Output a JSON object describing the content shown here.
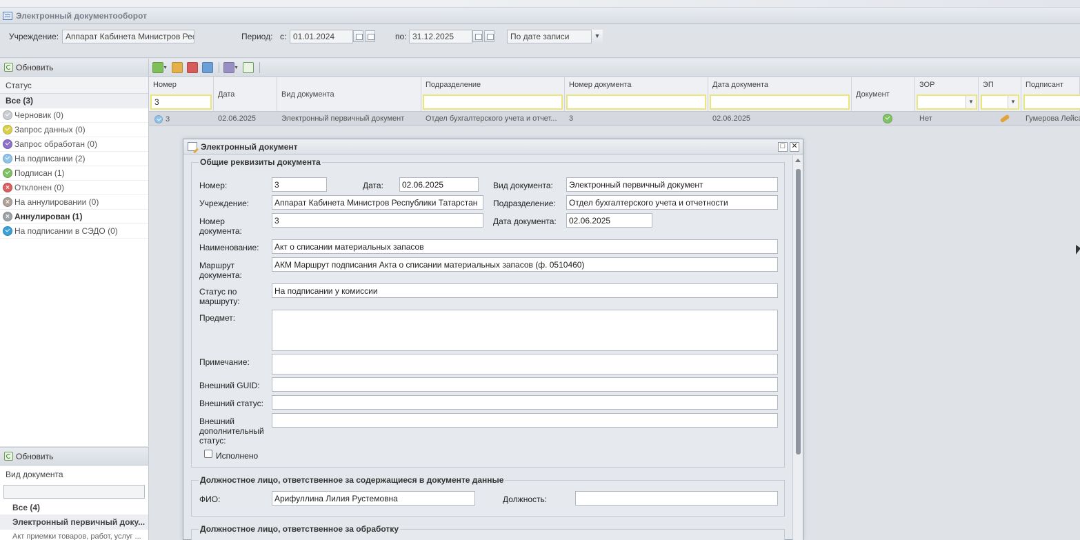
{
  "app": {
    "title": "Электронный документооборот"
  },
  "filters": {
    "institution_label": "Учреждение:",
    "institution_value": "Аппарат Кабинета Министров Рес",
    "period_label": "Период:",
    "from_label": "с:",
    "from_value": "01.01.2024",
    "to_label": "по:",
    "to_value": "31.12.2025",
    "date_mode": "По дате записи"
  },
  "status_panel": {
    "refresh_label": "Обновить",
    "header": "Статус",
    "items": [
      {
        "label": "Все (3)",
        "color": ""
      },
      {
        "label": "Черновик (0)",
        "color": "#c9cdd3"
      },
      {
        "label": "Запрос данных (0)",
        "color": "#d9d04a"
      },
      {
        "label": "Запрос обработан (0)",
        "color": "#8e6fc9"
      },
      {
        "label": "На подписании (2)",
        "color": "#8fc3ea"
      },
      {
        "label": "Подписан (1)",
        "color": "#7fc264"
      },
      {
        "label": "Отклонен (0)",
        "color": "#d96060"
      },
      {
        "label": "На аннулировании (0)",
        "color": "#b0a29b"
      },
      {
        "label": "Аннулирован (1)",
        "color": "#9ea3aa"
      },
      {
        "label": "На подписании в СЭДО (0)",
        "color": "#3aa0d8"
      }
    ]
  },
  "doctype_panel": {
    "refresh_label": "Обновить",
    "header": "Вид документа",
    "items": [
      {
        "label": "Все (4)"
      },
      {
        "label": "Электронный первичный доку..."
      },
      {
        "label": "Акт приемки товаров, работ, услуг ..."
      }
    ]
  },
  "grid": {
    "columns": [
      "Номер",
      "Дата",
      "Вид документа",
      "Подразделение",
      "Номер документа",
      "Дата документа",
      "Документ",
      "ЗОР",
      "ЭП",
      "Подписант"
    ],
    "filter_number": "3",
    "row": {
      "number": "3",
      "date": "02.06.2025",
      "doc_type": "Электронный первичный документ",
      "department": "Отдел бухгалтерского учета и отчет...",
      "doc_number": "3",
      "doc_date": "02.06.2025",
      "zor": "Нет",
      "signer": "Гумерова Лейсан"
    }
  },
  "dialog": {
    "title": "Электронный документ",
    "section_general": "Общие реквизиты документа",
    "labels": {
      "number": "Номер:",
      "date": "Дата:",
      "doc_type": "Вид документа:",
      "institution": "Учреждение:",
      "department": "Подразделение:",
      "doc_number": "Номер документа:",
      "doc_date": "Дата документа:",
      "name": "Наименование:",
      "route": "Маршрут документа:",
      "route_status": "Статус по маршруту:",
      "subject": "Предмет:",
      "note": "Примечание:",
      "ext_guid": "Внешний GUID:",
      "ext_status": "Внешний статус:",
      "ext_add_status": "Внешний дополнительный статус:",
      "done": "Исполнено"
    },
    "values": {
      "number": "3",
      "date": "02.06.2025",
      "doc_type": "Электронный первичный документ",
      "institution": "Аппарат Кабинета Министров Республики Татарстан",
      "department": "Отдел бухгалтерского учета и отчетности",
      "doc_number": "3",
      "doc_date": "02.06.2025",
      "name": "Акт о списании материальных запасов",
      "route": "АКМ Маршрут подписания Акта о списании материальных запасов (ф. 0510460)",
      "route_status": "На подписании у комиссии",
      "subject": "",
      "note": "",
      "ext_guid": "",
      "ext_status": "",
      "ext_add_status": ""
    },
    "section_responsible": "Должностное лицо, ответственное за содержащиеся в документе данные",
    "fio_label": "ФИО:",
    "fio_value": "Арифуллина Лилия Рустемовна",
    "position_label": "Должность:",
    "position_value": "",
    "section_processing": "Должностное лицо, ответственное за обработку"
  }
}
